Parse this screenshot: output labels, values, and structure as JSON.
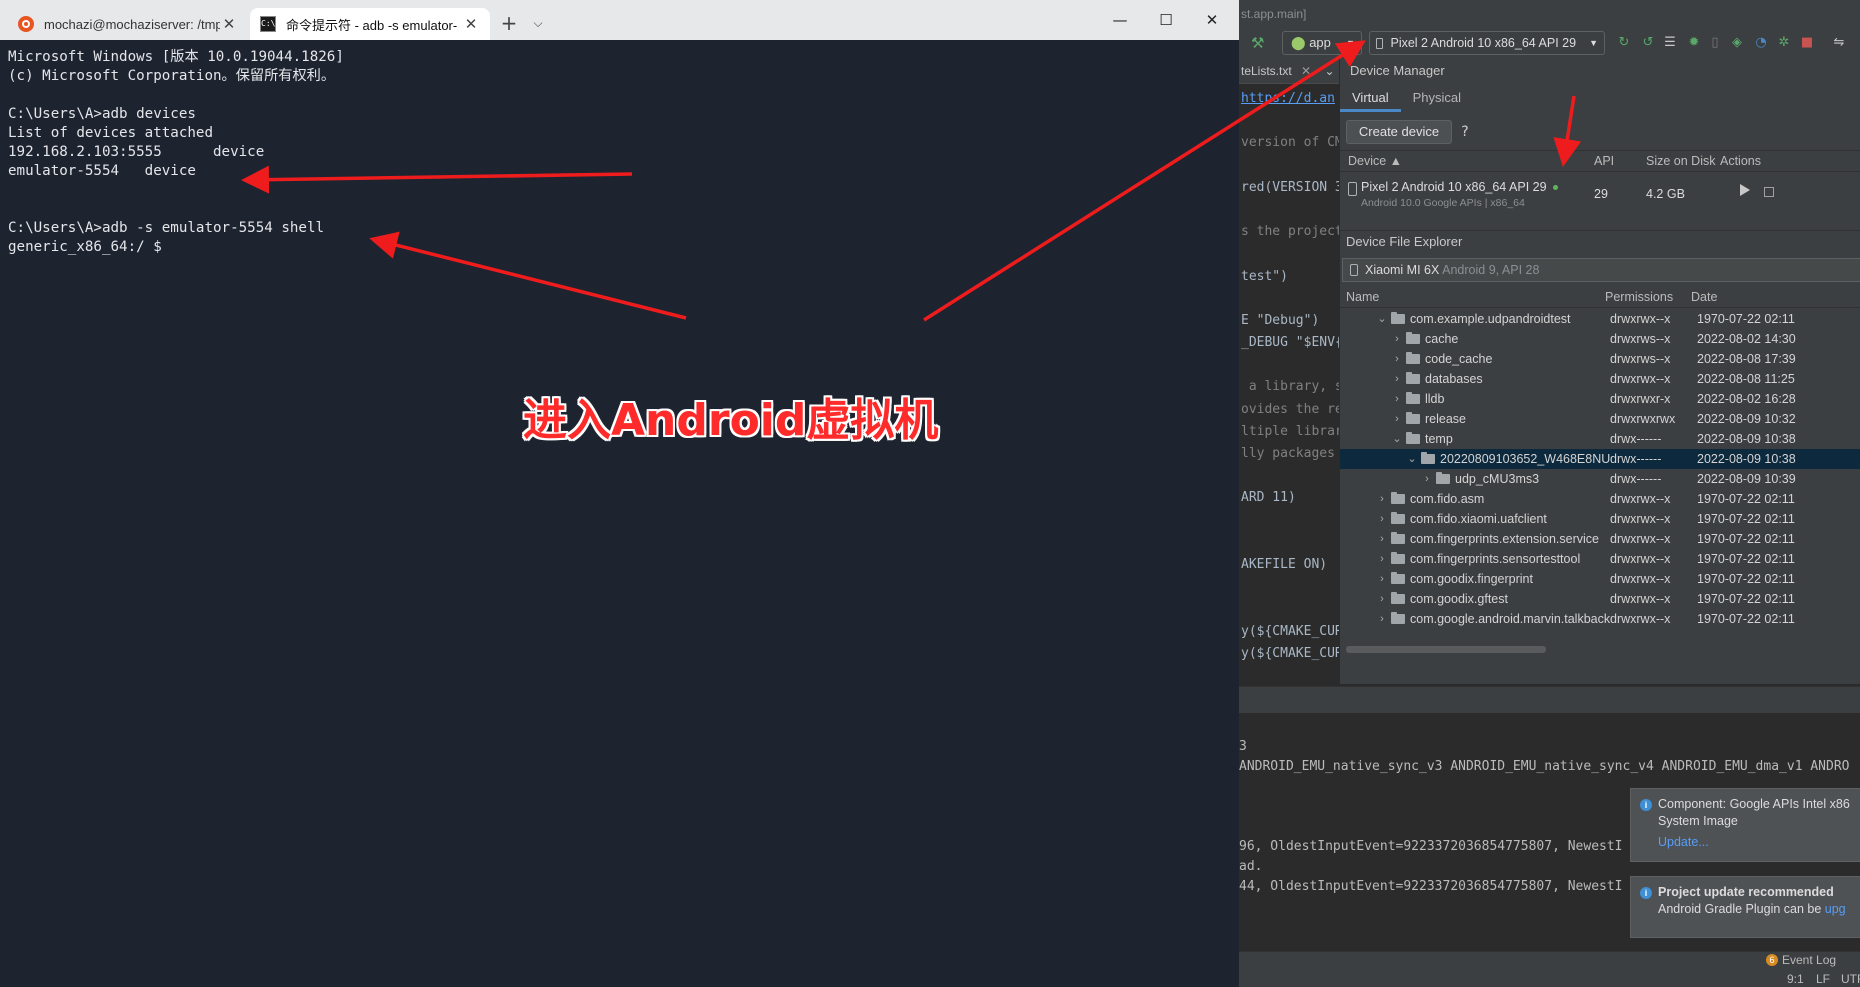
{
  "terminal": {
    "tabs": [
      {
        "label": "mochazi@mochaziserver: /tmp",
        "icon": "ubuntu-icon",
        "active": false
      },
      {
        "label": "命令提示符 - adb  -s emulator-",
        "icon": "cmd-icon",
        "active": true
      }
    ],
    "new_tab": "+",
    "tab_dropdown": "⌵",
    "window_controls": {
      "minimize": "—",
      "maximize": "☐",
      "close": "✕"
    },
    "lines": [
      "Microsoft Windows [版本 10.0.19044.1826]",
      "(c) Microsoft Corporation。保留所有权利。",
      "",
      "C:\\Users\\A>adb devices",
      "List of devices attached",
      "192.168.2.103:5555      device",
      "emulator-5554   device",
      "",
      "",
      "C:\\Users\\A>adb -s emulator-5554 shell",
      "generic_x86_64:/ $"
    ]
  },
  "annotation": {
    "text": "进入Android虚拟机",
    "color": "#ff2a2a"
  },
  "studio": {
    "title_fragment": "st.app.main]",
    "run_config": "app",
    "selected_device": "Pixel 2 Android 10 x86_64 API 29",
    "editor_tab": "teLists.txt",
    "code_lines": [
      {
        "text": "https://d.an",
        "cls": "t-link"
      },
      {
        "text": "",
        "cls": ""
      },
      {
        "text": "version of CM",
        "cls": "t-com"
      },
      {
        "text": "",
        "cls": ""
      },
      {
        "text": "red(VERSION 3",
        "cls": ""
      },
      {
        "text": "",
        "cls": ""
      },
      {
        "text": "s the project",
        "cls": "t-com"
      },
      {
        "text": "",
        "cls": ""
      },
      {
        "text": "test\")",
        "cls": ""
      },
      {
        "text": "",
        "cls": ""
      },
      {
        "text": "E \"Debug\")",
        "cls": ""
      },
      {
        "text": "_DEBUG \"$ENV{",
        "cls": ""
      },
      {
        "text": "",
        "cls": ""
      },
      {
        "text": " a library, s",
        "cls": "t-com"
      },
      {
        "text": "ovides the re",
        "cls": "t-com"
      },
      {
        "text": "ltiple librar",
        "cls": "t-com"
      },
      {
        "text": "lly packages ",
        "cls": "t-com"
      },
      {
        "text": "",
        "cls": ""
      },
      {
        "text": "ARD 11)",
        "cls": ""
      },
      {
        "text": "",
        "cls": ""
      },
      {
        "text": "",
        "cls": ""
      },
      {
        "text": "AKEFILE ON)",
        "cls": ""
      },
      {
        "text": "",
        "cls": ""
      },
      {
        "text": "",
        "cls": ""
      },
      {
        "text": "y(${CMAKE_CUR",
        "cls": ""
      },
      {
        "text": "y(${CMAKE_CUR",
        "cls": ""
      }
    ],
    "device_manager": {
      "title": "Device Manager",
      "tabs": [
        "Virtual",
        "Physical"
      ],
      "create_button": "Create device",
      "help": "?",
      "columns": {
        "device": "Device ▲",
        "api": "API",
        "size": "Size on Disk",
        "actions": "Actions"
      },
      "devices": [
        {
          "name": "Pixel 2 Android 10 x86_64 API 29",
          "sub": "Android 10.0 Google APIs | x86_64",
          "api": "29",
          "size": "4.2 GB",
          "online": true
        }
      ]
    },
    "file_explorer": {
      "title": "Device File Explorer",
      "device": "Xiaomi MI 6X",
      "device_sub": "Android 9, API 28",
      "columns": {
        "name": "Name",
        "permissions": "Permissions",
        "date": "Date"
      },
      "rows": [
        {
          "name": "com.example.udpandroidtest",
          "perm": "drwxrwx--x",
          "date": "1970-07-22 02:11",
          "depth": 0,
          "expanded": true
        },
        {
          "name": "cache",
          "perm": "drwxrws--x",
          "date": "2022-08-02 14:30",
          "depth": 1,
          "expanded": false
        },
        {
          "name": "code_cache",
          "perm": "drwxrws--x",
          "date": "2022-08-08 17:39",
          "depth": 1,
          "expanded": false
        },
        {
          "name": "databases",
          "perm": "drwxrwx--x",
          "date": "2022-08-08 11:25",
          "depth": 1,
          "expanded": false
        },
        {
          "name": "lldb",
          "perm": "drwxrwxr-x",
          "date": "2022-08-02 16:28",
          "depth": 1,
          "expanded": false
        },
        {
          "name": "release",
          "perm": "drwxrwxrwx",
          "date": "2022-08-09 10:32",
          "depth": 1,
          "expanded": false
        },
        {
          "name": "temp",
          "perm": "drwx------",
          "date": "2022-08-09 10:38",
          "depth": 1,
          "expanded": true
        },
        {
          "name": "20220809103652_W468E8NU",
          "perm": "drwx------",
          "date": "2022-08-09 10:38",
          "depth": 2,
          "expanded": true,
          "selected": true
        },
        {
          "name": "udp_cMU3ms3",
          "perm": "drwx------",
          "date": "2022-08-09 10:39",
          "depth": 3,
          "expanded": false
        },
        {
          "name": "com.fido.asm",
          "perm": "drwxrwx--x",
          "date": "1970-07-22 02:11",
          "depth": 0,
          "expanded": false
        },
        {
          "name": "com.fido.xiaomi.uafclient",
          "perm": "drwxrwx--x",
          "date": "1970-07-22 02:11",
          "depth": 0,
          "expanded": false
        },
        {
          "name": "com.fingerprints.extension.service",
          "perm": "drwxrwx--x",
          "date": "1970-07-22 02:11",
          "depth": 0,
          "expanded": false
        },
        {
          "name": "com.fingerprints.sensortesttool",
          "perm": "drwxrwx--x",
          "date": "1970-07-22 02:11",
          "depth": 0,
          "expanded": false
        },
        {
          "name": "com.goodix.fingerprint",
          "perm": "drwxrwx--x",
          "date": "1970-07-22 02:11",
          "depth": 0,
          "expanded": false
        },
        {
          "name": "com.goodix.gftest",
          "perm": "drwxrwx--x",
          "date": "1970-07-22 02:11",
          "depth": 0,
          "expanded": false
        },
        {
          "name": "com.google.android.marvin.talkback",
          "perm": "drwxrwx--x",
          "date": "1970-07-22 02:11",
          "depth": 0,
          "expanded": false
        }
      ]
    },
    "console_lines": [
      "3",
      "ANDROID_EMU_native_sync_v3 ANDROID_EMU_native_sync_v4 ANDROID_EMU_dma_v1 ANDRO",
      "",
      "",
      "",
      "96, OldestInputEvent=9223372036854775807, NewestI",
      "ad.",
      "44, OldestInputEvent=9223372036854775807, NewestI"
    ],
    "notifications": [
      {
        "title": "Component: Google APIs Intel x86",
        "line2": "System Image",
        "link": "Update..."
      },
      {
        "title": "Project update recommended",
        "line2": "Android Gradle Plugin can be ",
        "line2_link": "upg"
      }
    ],
    "status": {
      "event_badge": "6",
      "event_log": "Event Log",
      "position": "9:1",
      "line_sep": "LF",
      "encoding": "UTF"
    }
  }
}
